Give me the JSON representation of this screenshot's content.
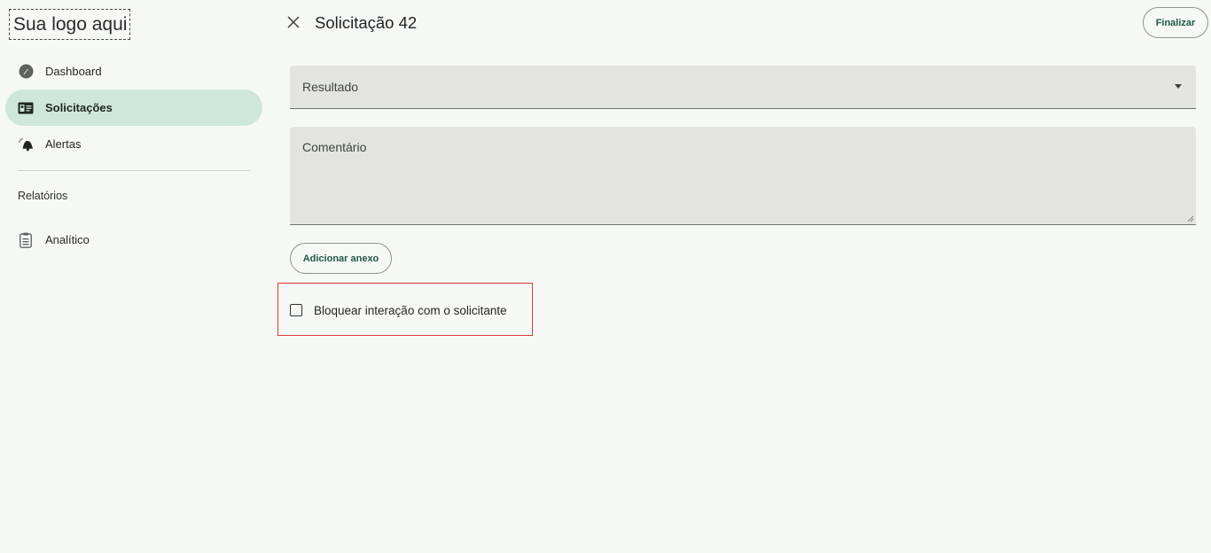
{
  "logo": {
    "text": "Sua logo aqui"
  },
  "sidebar": {
    "items": [
      {
        "label": "Dashboard",
        "icon": "dashboard-gauge-icon"
      },
      {
        "label": "Solicitações",
        "icon": "id-card-icon",
        "active": true
      },
      {
        "label": "Alertas",
        "icon": "bell-icon"
      }
    ],
    "section_label": "Relatórios",
    "report_items": [
      {
        "label": "Analítico",
        "icon": "report-clipboard-icon"
      }
    ]
  },
  "header": {
    "title": "Solicitação 42",
    "close_icon": "close-icon",
    "finalize_label": "Finalizar"
  },
  "form": {
    "result_label": "Resultado",
    "comment_label": "Comentário",
    "attach_label": "Adicionar anexo",
    "block_checkbox_label": "Bloquear interação com o solicitante",
    "block_checked": false
  },
  "colors": {
    "background": "#f6f8f6",
    "active_nav": "#cfe6dc",
    "accent_text": "#1e5a45",
    "field_bg": "#e3e4e2",
    "highlight": "#d93a3a"
  }
}
